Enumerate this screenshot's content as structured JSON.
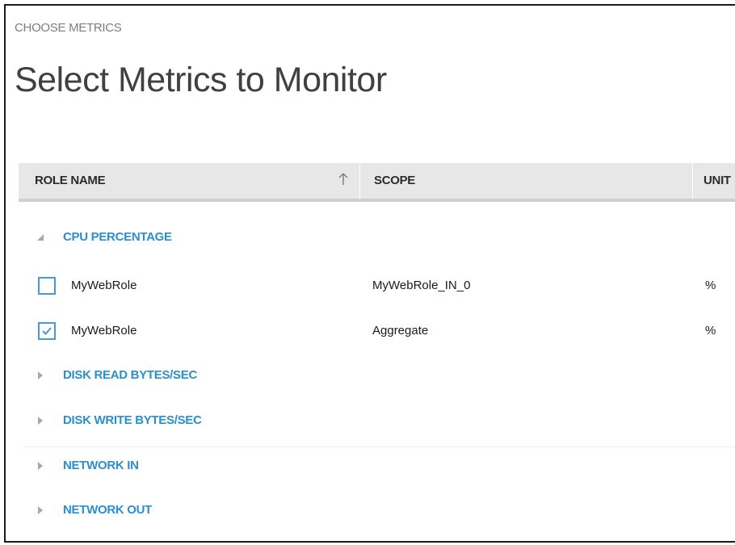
{
  "section_label": "CHOOSE METRICS",
  "page_title": "Select Metrics to Monitor",
  "table": {
    "columns": {
      "role_name": "ROLE NAME",
      "scope": "SCOPE",
      "unit": "UNIT"
    },
    "sort": {
      "column": "role_name",
      "direction": "ascending",
      "icon": "arrow-up-icon"
    }
  },
  "groups": [
    {
      "label": "CPU PERCENTAGE",
      "expanded": true,
      "rows": [
        {
          "role": "MyWebRole",
          "scope": "MyWebRole_IN_0",
          "unit": "%",
          "checked": false
        },
        {
          "role": "MyWebRole",
          "scope": "Aggregate",
          "unit": "%",
          "checked": true
        }
      ]
    },
    {
      "label": "DISK READ BYTES/SEC",
      "expanded": false
    },
    {
      "label": "DISK WRITE BYTES/SEC",
      "expanded": false
    },
    {
      "label": "NETWORK IN",
      "expanded": false
    },
    {
      "label": "NETWORK OUT",
      "expanded": false
    }
  ],
  "colors": {
    "accent": "#2a8fcd",
    "checkbox_border": "#4a98d6",
    "header_bg": "#e7e7e7",
    "title_text": "#404040",
    "section_label_text": "#7d7d7d"
  }
}
